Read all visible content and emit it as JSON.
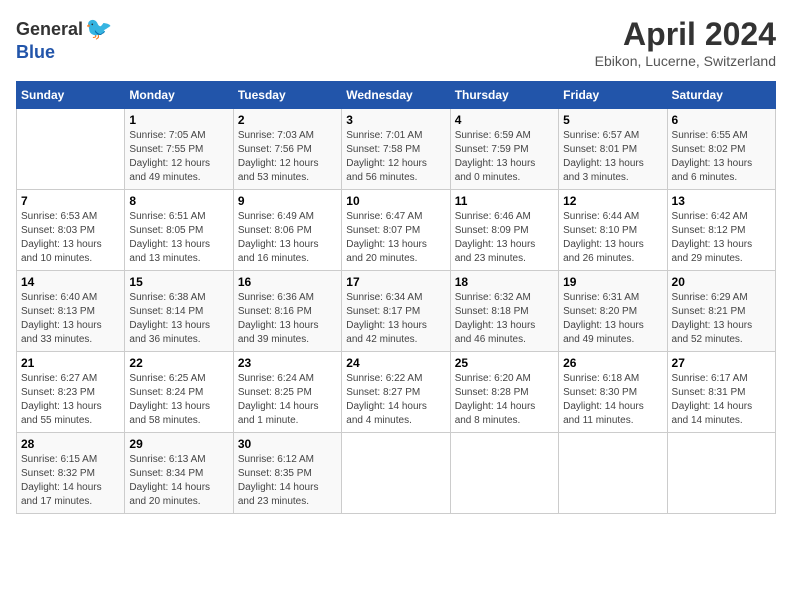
{
  "header": {
    "logo_general": "General",
    "logo_blue": "Blue",
    "month_title": "April 2024",
    "location": "Ebikon, Lucerne, Switzerland"
  },
  "calendar": {
    "days_of_week": [
      "Sunday",
      "Monday",
      "Tuesday",
      "Wednesday",
      "Thursday",
      "Friday",
      "Saturday"
    ],
    "weeks": [
      [
        {
          "day": "",
          "info": ""
        },
        {
          "day": "1",
          "info": "Sunrise: 7:05 AM\nSunset: 7:55 PM\nDaylight: 12 hours\nand 49 minutes."
        },
        {
          "day": "2",
          "info": "Sunrise: 7:03 AM\nSunset: 7:56 PM\nDaylight: 12 hours\nand 53 minutes."
        },
        {
          "day": "3",
          "info": "Sunrise: 7:01 AM\nSunset: 7:58 PM\nDaylight: 12 hours\nand 56 minutes."
        },
        {
          "day": "4",
          "info": "Sunrise: 6:59 AM\nSunset: 7:59 PM\nDaylight: 13 hours\nand 0 minutes."
        },
        {
          "day": "5",
          "info": "Sunrise: 6:57 AM\nSunset: 8:01 PM\nDaylight: 13 hours\nand 3 minutes."
        },
        {
          "day": "6",
          "info": "Sunrise: 6:55 AM\nSunset: 8:02 PM\nDaylight: 13 hours\nand 6 minutes."
        }
      ],
      [
        {
          "day": "7",
          "info": "Sunrise: 6:53 AM\nSunset: 8:03 PM\nDaylight: 13 hours\nand 10 minutes."
        },
        {
          "day": "8",
          "info": "Sunrise: 6:51 AM\nSunset: 8:05 PM\nDaylight: 13 hours\nand 13 minutes."
        },
        {
          "day": "9",
          "info": "Sunrise: 6:49 AM\nSunset: 8:06 PM\nDaylight: 13 hours\nand 16 minutes."
        },
        {
          "day": "10",
          "info": "Sunrise: 6:47 AM\nSunset: 8:07 PM\nDaylight: 13 hours\nand 20 minutes."
        },
        {
          "day": "11",
          "info": "Sunrise: 6:46 AM\nSunset: 8:09 PM\nDaylight: 13 hours\nand 23 minutes."
        },
        {
          "day": "12",
          "info": "Sunrise: 6:44 AM\nSunset: 8:10 PM\nDaylight: 13 hours\nand 26 minutes."
        },
        {
          "day": "13",
          "info": "Sunrise: 6:42 AM\nSunset: 8:12 PM\nDaylight: 13 hours\nand 29 minutes."
        }
      ],
      [
        {
          "day": "14",
          "info": "Sunrise: 6:40 AM\nSunset: 8:13 PM\nDaylight: 13 hours\nand 33 minutes."
        },
        {
          "day": "15",
          "info": "Sunrise: 6:38 AM\nSunset: 8:14 PM\nDaylight: 13 hours\nand 36 minutes."
        },
        {
          "day": "16",
          "info": "Sunrise: 6:36 AM\nSunset: 8:16 PM\nDaylight: 13 hours\nand 39 minutes."
        },
        {
          "day": "17",
          "info": "Sunrise: 6:34 AM\nSunset: 8:17 PM\nDaylight: 13 hours\nand 42 minutes."
        },
        {
          "day": "18",
          "info": "Sunrise: 6:32 AM\nSunset: 8:18 PM\nDaylight: 13 hours\nand 46 minutes."
        },
        {
          "day": "19",
          "info": "Sunrise: 6:31 AM\nSunset: 8:20 PM\nDaylight: 13 hours\nand 49 minutes."
        },
        {
          "day": "20",
          "info": "Sunrise: 6:29 AM\nSunset: 8:21 PM\nDaylight: 13 hours\nand 52 minutes."
        }
      ],
      [
        {
          "day": "21",
          "info": "Sunrise: 6:27 AM\nSunset: 8:23 PM\nDaylight: 13 hours\nand 55 minutes."
        },
        {
          "day": "22",
          "info": "Sunrise: 6:25 AM\nSunset: 8:24 PM\nDaylight: 13 hours\nand 58 minutes."
        },
        {
          "day": "23",
          "info": "Sunrise: 6:24 AM\nSunset: 8:25 PM\nDaylight: 14 hours\nand 1 minute."
        },
        {
          "day": "24",
          "info": "Sunrise: 6:22 AM\nSunset: 8:27 PM\nDaylight: 14 hours\nand 4 minutes."
        },
        {
          "day": "25",
          "info": "Sunrise: 6:20 AM\nSunset: 8:28 PM\nDaylight: 14 hours\nand 8 minutes."
        },
        {
          "day": "26",
          "info": "Sunrise: 6:18 AM\nSunset: 8:30 PM\nDaylight: 14 hours\nand 11 minutes."
        },
        {
          "day": "27",
          "info": "Sunrise: 6:17 AM\nSunset: 8:31 PM\nDaylight: 14 hours\nand 14 minutes."
        }
      ],
      [
        {
          "day": "28",
          "info": "Sunrise: 6:15 AM\nSunset: 8:32 PM\nDaylight: 14 hours\nand 17 minutes."
        },
        {
          "day": "29",
          "info": "Sunrise: 6:13 AM\nSunset: 8:34 PM\nDaylight: 14 hours\nand 20 minutes."
        },
        {
          "day": "30",
          "info": "Sunrise: 6:12 AM\nSunset: 8:35 PM\nDaylight: 14 hours\nand 23 minutes."
        },
        {
          "day": "",
          "info": ""
        },
        {
          "day": "",
          "info": ""
        },
        {
          "day": "",
          "info": ""
        },
        {
          "day": "",
          "info": ""
        }
      ]
    ]
  }
}
